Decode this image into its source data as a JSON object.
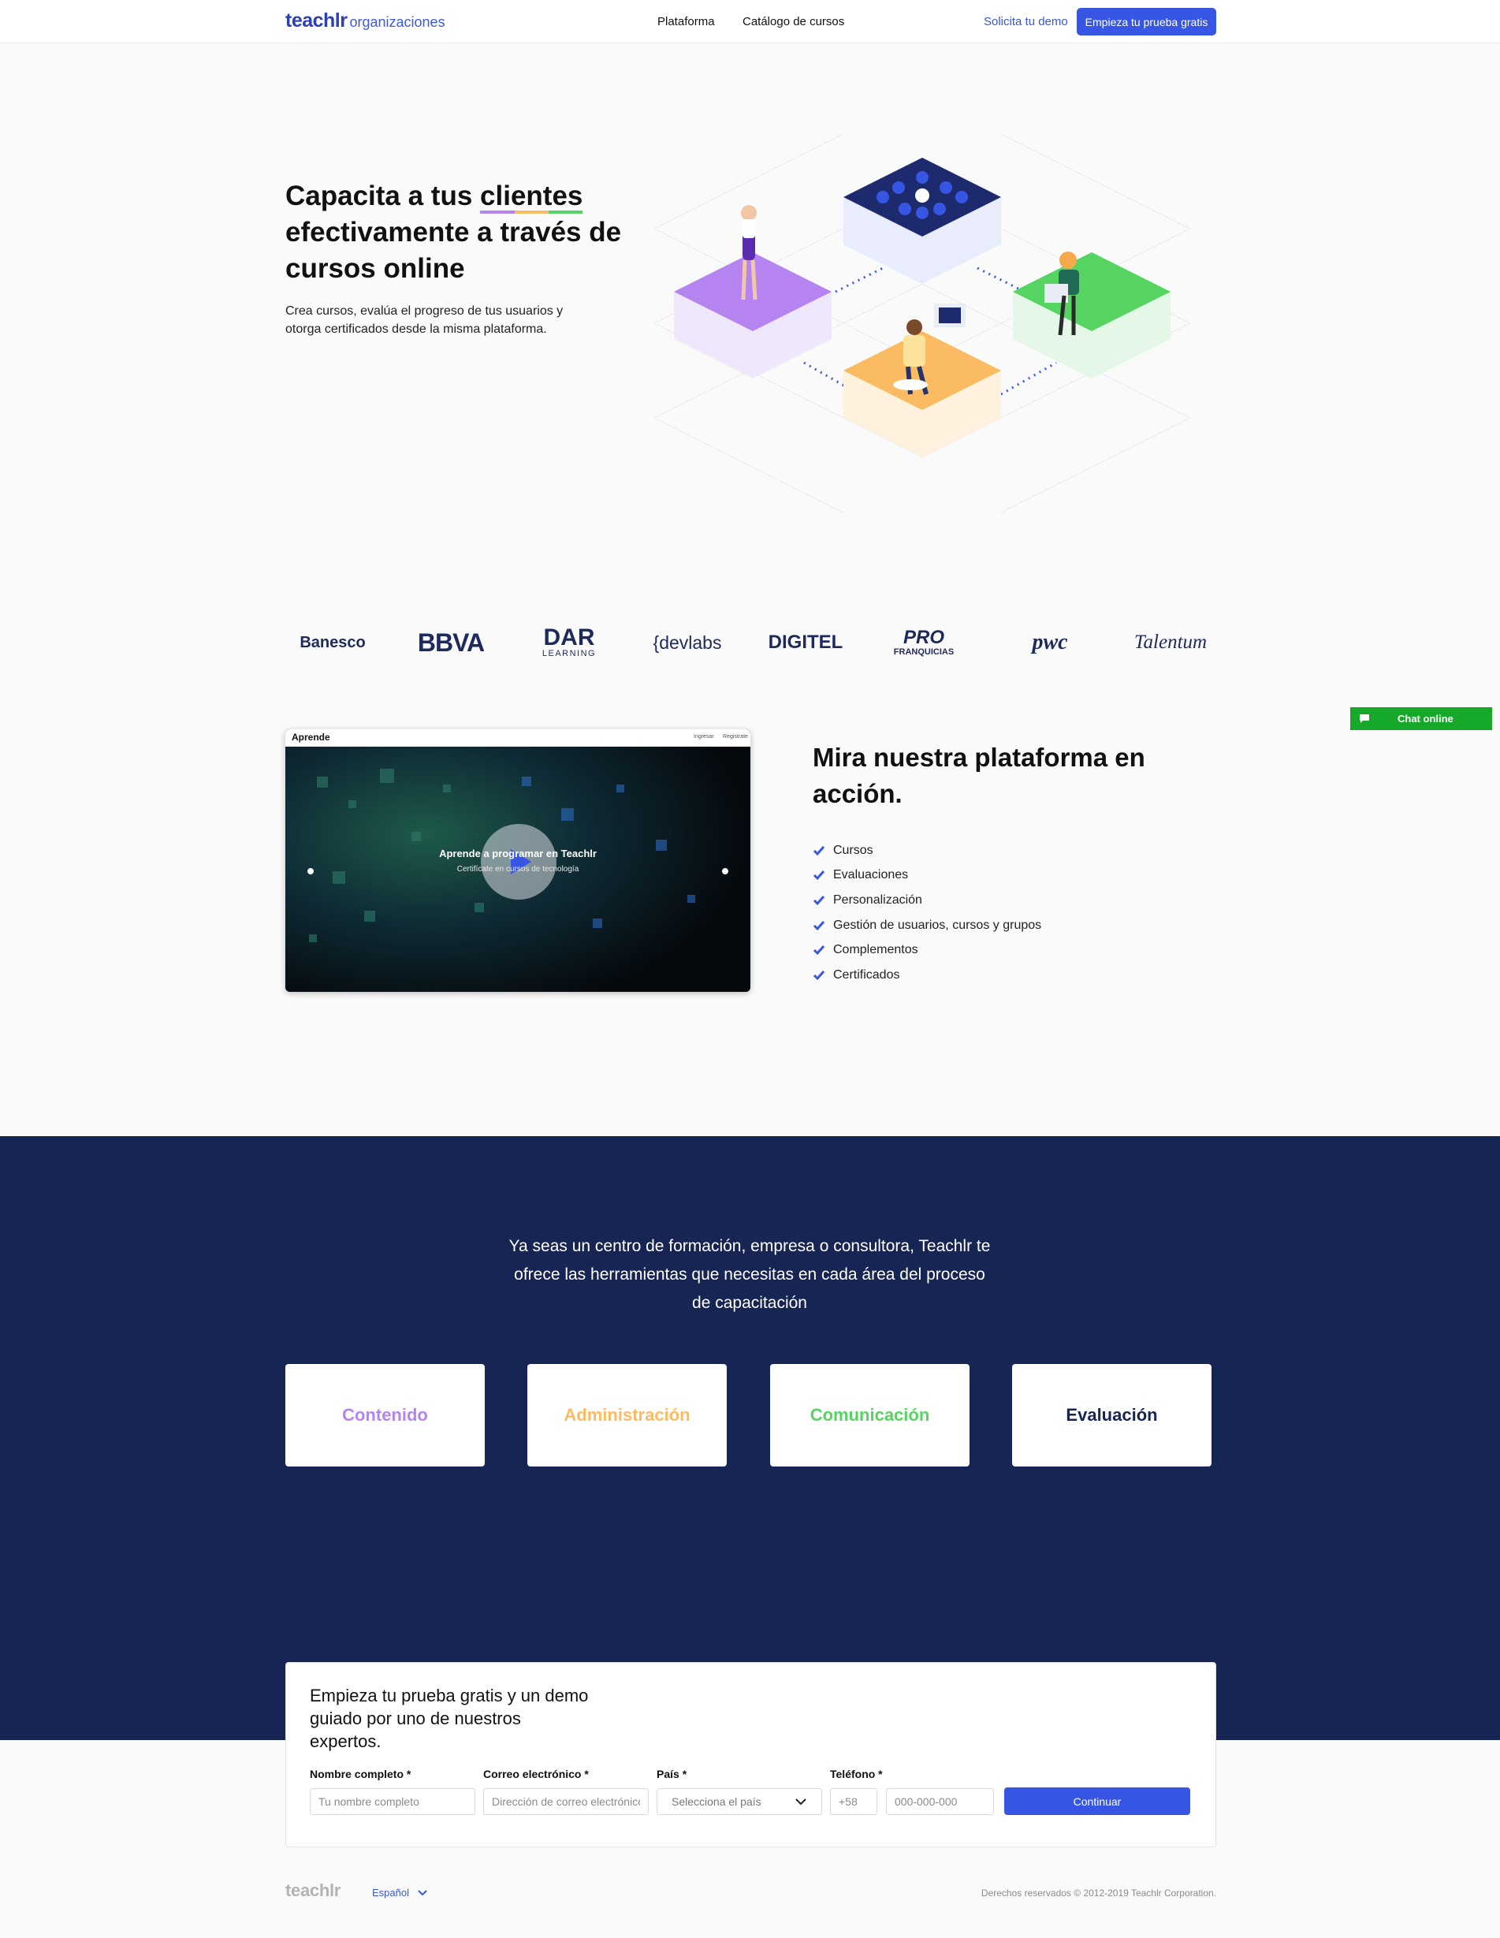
{
  "header": {
    "brand_main": "teachlr",
    "brand_sub": "organizaciones",
    "nav": [
      "Plataforma",
      "Catálogo de cursos"
    ],
    "demo_link": "Solicita tu demo",
    "trial_button": "Empieza tu prueba gratis"
  },
  "hero": {
    "title_before": "Capacita a tus ",
    "title_highlight": "clientes",
    "title_after": " efectivamente a través de cursos online",
    "subtitle": "Crea cursos, evalúa el progreso de tus usuarios y otorga certificados desde la misma plataforma."
  },
  "clients": [
    "Banesco",
    "BBVA",
    "DAR",
    "LEARNING",
    "{devlabs",
    "DIGITEL",
    "PRO",
    "FRANQUICIAS",
    "pwc",
    "Talentum"
  ],
  "platform": {
    "video": {
      "site_name": "Aprende",
      "links": [
        "Ingresar",
        "Registrate"
      ],
      "headline": "Aprende a programar en Teachlr",
      "subline": "Certifícate en cursos de tecnología"
    },
    "title": "Mira nuestra plataforma en acción.",
    "features": [
      "Cursos",
      "Evaluaciones",
      "Personalización",
      "Gestión de usuarios, cursos y grupos",
      "Complementos",
      "Certificados"
    ]
  },
  "areas": {
    "intro": "Ya seas un centro de formación, empresa o consultora, Teachlr te ofrece las herramientas que necesitas en cada área del proceso de capacitación",
    "cards": [
      {
        "label": "Contenido",
        "color": "#b584f0"
      },
      {
        "label": "Administración",
        "color": "#fbbb63"
      },
      {
        "label": "Comunicación",
        "color": "#55d462"
      },
      {
        "label": "Evaluación",
        "color": "#172554"
      }
    ]
  },
  "form": {
    "title": "Empieza tu prueba gratis y un demo guiado por uno de nuestros expertos.",
    "name_label": "Nombre completo *",
    "name_placeholder": "Tu nombre completo",
    "email_label": "Correo electrónico *",
    "email_placeholder": "Dirección de correo electrónico",
    "country_label": "País *",
    "country_value": "Selecciona el país",
    "phone_label": "Teléfono *",
    "phone_code": "+58",
    "phone_placeholder": "000-000-000",
    "submit": "Continuar"
  },
  "footer": {
    "logo": "teachlr",
    "language": "Español",
    "copyright": "Derechos reservados © 2012-2019 Teachlr Corporation."
  },
  "chat": {
    "label": "Chat online"
  },
  "colors": {
    "primary": "#3656e3",
    "navy": "#172554",
    "purple": "#b584f0",
    "orange": "#fbbb63",
    "green": "#55d462",
    "chat_green": "#16a828"
  }
}
